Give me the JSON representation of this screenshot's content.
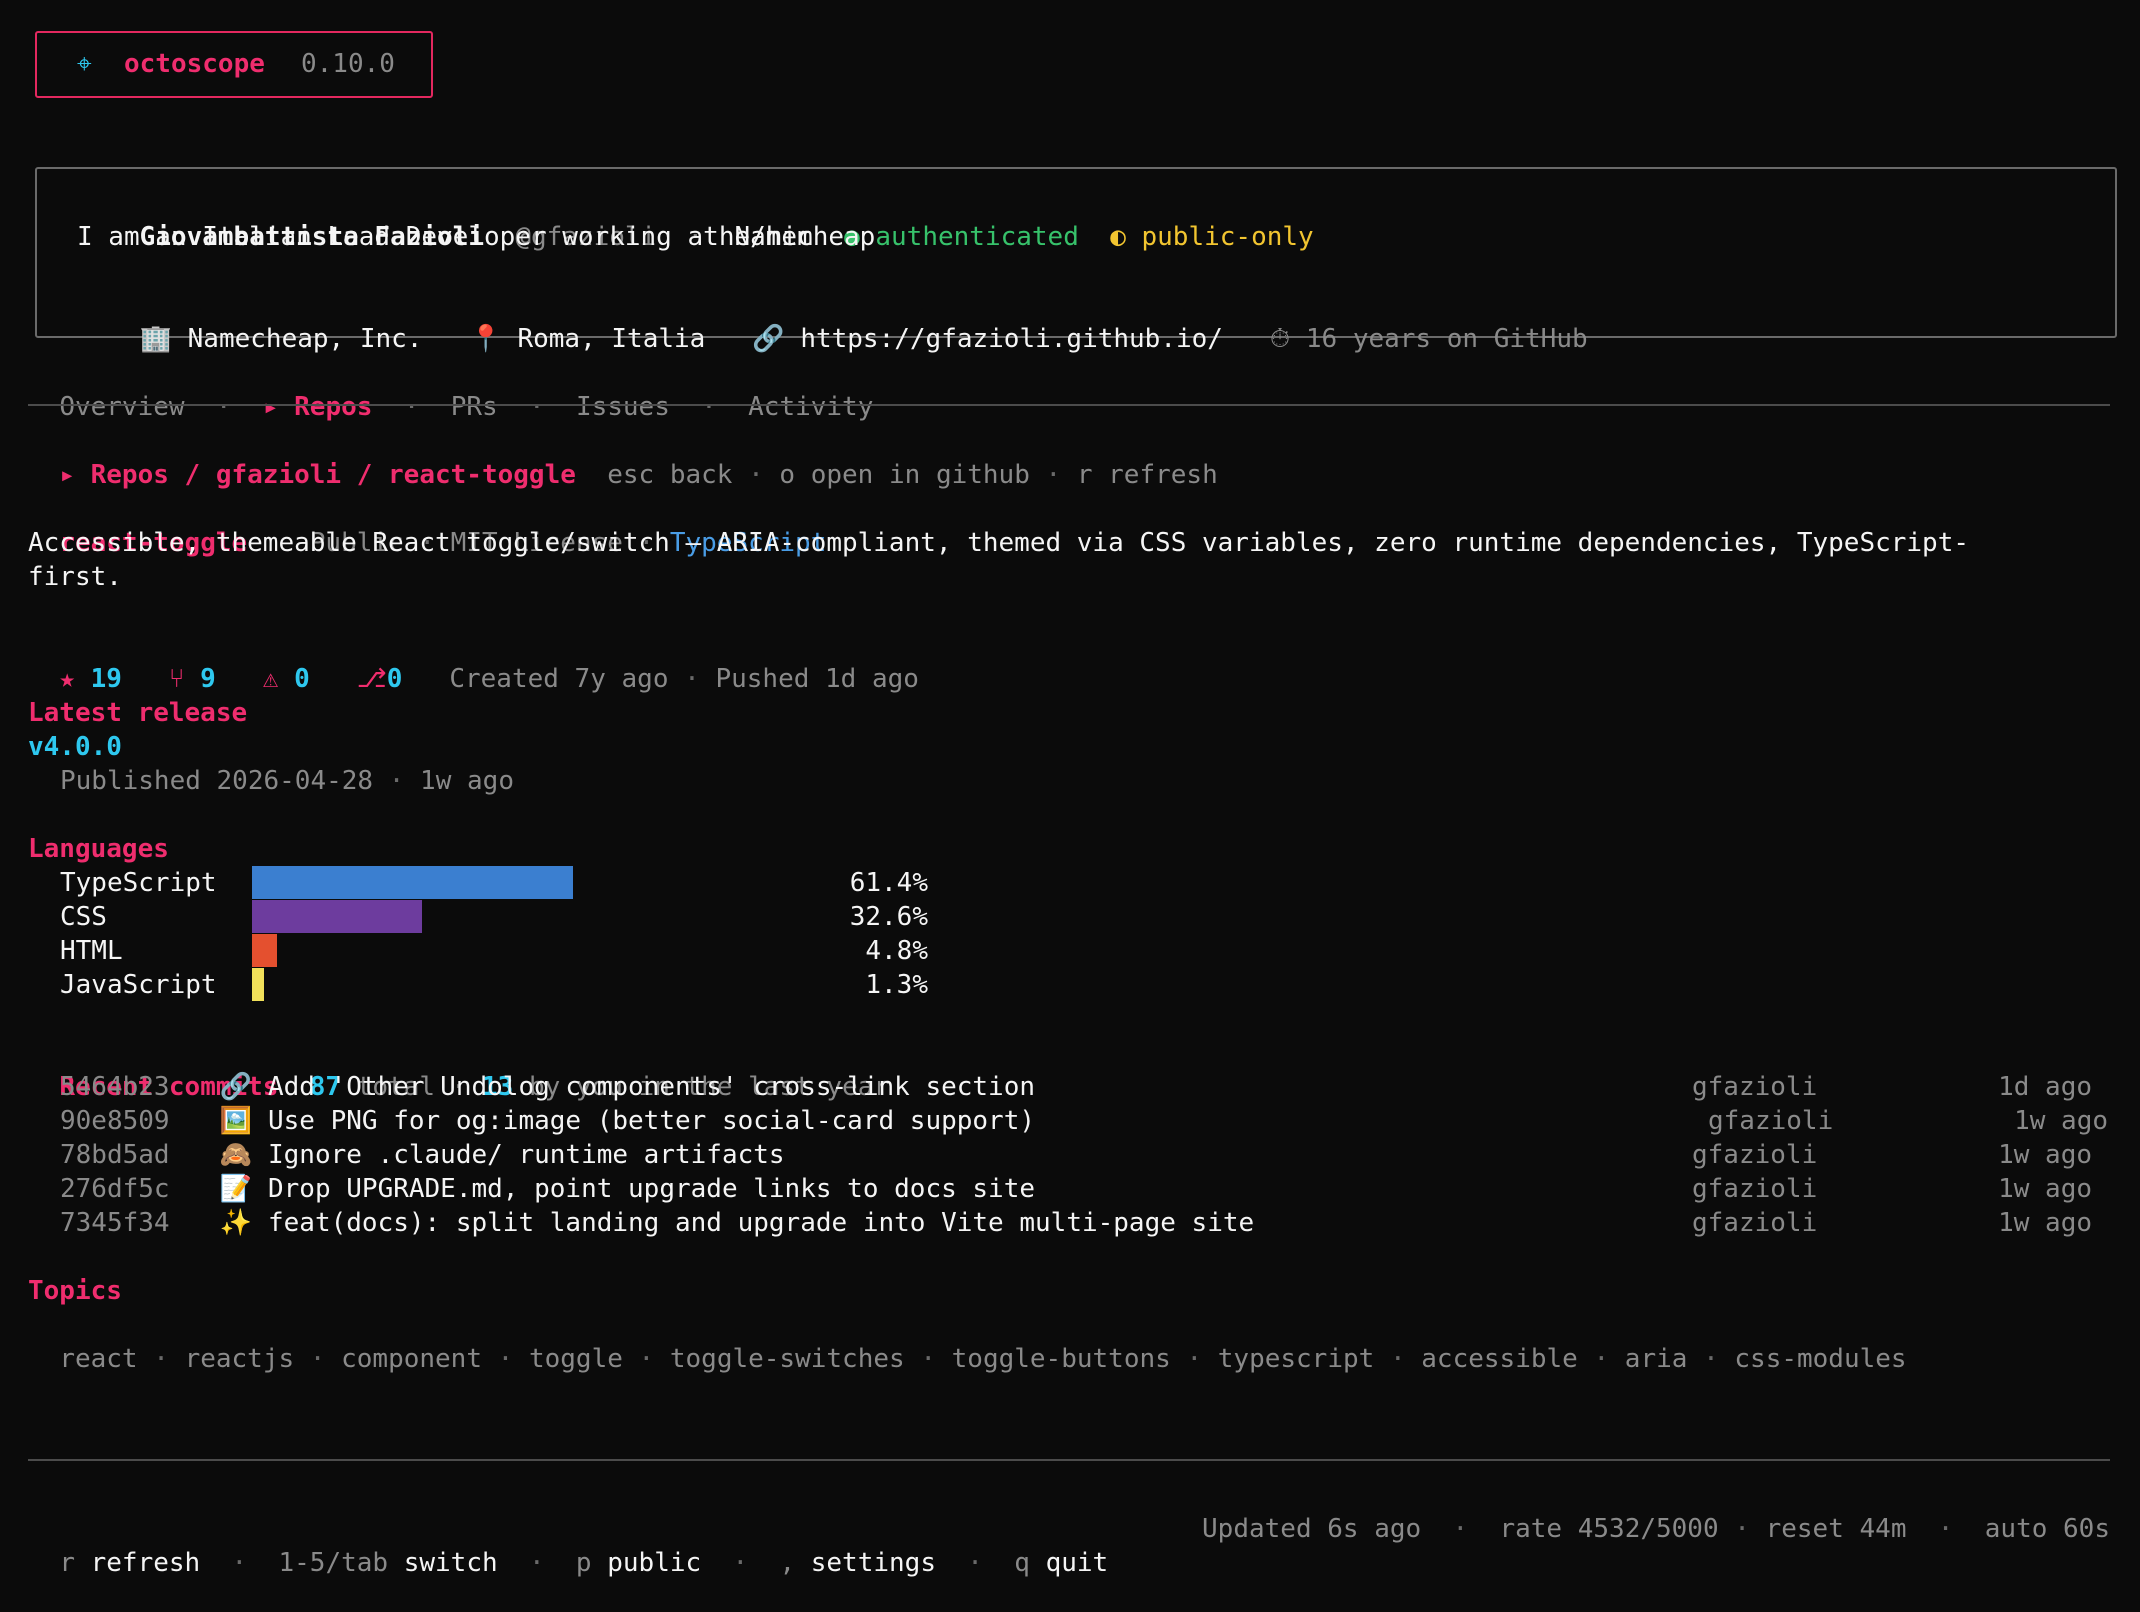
{
  "app": {
    "icon": "⌖",
    "name": "octoscope",
    "version": "0.10.0"
  },
  "profile": {
    "name": "Giovambattista Fazioli",
    "handle": "@gfazioli",
    "pronouns": "he/him",
    "auth_status": "authenticated",
    "access_mode": "public-only",
    "bio": "I am an Italian Lead Developer working at Namecheap",
    "company": "Namecheap, Inc.",
    "location": "Roma, Italia",
    "website": "https://gfazioli.github.io/",
    "tenure": "16 years on GitHub"
  },
  "tabs": [
    {
      "label": "Overview"
    },
    {
      "label": "▸ Repos",
      "active": true
    },
    {
      "label": "PRs"
    },
    {
      "label": "Issues"
    },
    {
      "label": "Activity"
    }
  ],
  "breadcrumb": {
    "path": "▸ Repos / gfazioli / react-toggle",
    "hints": [
      {
        "key": "esc",
        "label": "back"
      },
      {
        "key": "o",
        "label": "open in github"
      },
      {
        "key": "r",
        "label": "refresh"
      }
    ]
  },
  "repo": {
    "name": "react-toggle",
    "visibility": "Public",
    "license": "MIT License",
    "language": "TypeScript",
    "description_line1": "Accessible, themeable React toggle/switch — ARIA-compliant, themed via CSS variables, zero runtime dependencies, TypeScript-",
    "description_line2": "first.",
    "stars": "19",
    "forks": "9",
    "issues": "0",
    "prs": "0",
    "created": "Created 7y ago",
    "pushed": "Pushed 1d ago"
  },
  "release": {
    "heading": "Latest release",
    "tag": "v4.0.0",
    "published": "Published 2026-04-28",
    "ago": "1w ago"
  },
  "languages": {
    "heading": "Languages",
    "items": [
      {
        "name": "TypeScript",
        "percent": 61.4,
        "label": "61.4%",
        "color": "#3b7fd0"
      },
      {
        "name": "CSS",
        "percent": 32.6,
        "label": "32.6%",
        "color": "#6d3c9e"
      },
      {
        "name": "HTML",
        "percent": 4.8,
        "label": "4.8%",
        "color": "#e4502f"
      },
      {
        "name": "JavaScript",
        "percent": 1.3,
        "label": "1.3%",
        "color": "#f1e05a"
      }
    ]
  },
  "commits": {
    "heading": "Recent commits",
    "total": "87",
    "total_label": "total",
    "yours": "13",
    "yours_label": "by you in the last year",
    "items": [
      {
        "sha": "5464b23",
        "emoji": "🔗",
        "message": "Add 'Other Undolog components' cross-link section",
        "author": "gfazioli",
        "time": "1d ago"
      },
      {
        "sha": "90e8509",
        "emoji": "🖼️",
        "message": "Use PNG for og:image (better social-card support)",
        "author": "gfazioli",
        "time": "1w ago"
      },
      {
        "sha": "78bd5ad",
        "emoji": "🙈",
        "message": "Ignore .claude/ runtime artifacts",
        "author": "gfazioli",
        "time": "1w ago"
      },
      {
        "sha": "276df5c",
        "emoji": "📝",
        "message": "Drop UPGRADE.md, point upgrade links to docs site",
        "author": "gfazioli",
        "time": "1w ago"
      },
      {
        "sha": "7345f34",
        "emoji": "✨",
        "message": "feat(docs): split landing and upgrade into Vite multi-page site",
        "author": "gfazioli",
        "time": "1w ago"
      }
    ]
  },
  "topics": {
    "heading": "Topics",
    "items": [
      "react",
      "reactjs",
      "component",
      "toggle",
      "toggle-switches",
      "toggle-buttons",
      "typescript",
      "accessible",
      "aria",
      "css-modules"
    ]
  },
  "footer": {
    "shortcuts": [
      {
        "key": "r",
        "label": "refresh"
      },
      {
        "key": "1-5/tab",
        "label": "switch"
      },
      {
        "key": "p",
        "label": "public"
      },
      {
        "key": ",",
        "label": "settings"
      },
      {
        "key": "q",
        "label": "quit"
      }
    ],
    "updated": "Updated 6s ago",
    "rate": "rate 4532/5000",
    "reset": "reset 44m",
    "auto": "auto 60s"
  }
}
